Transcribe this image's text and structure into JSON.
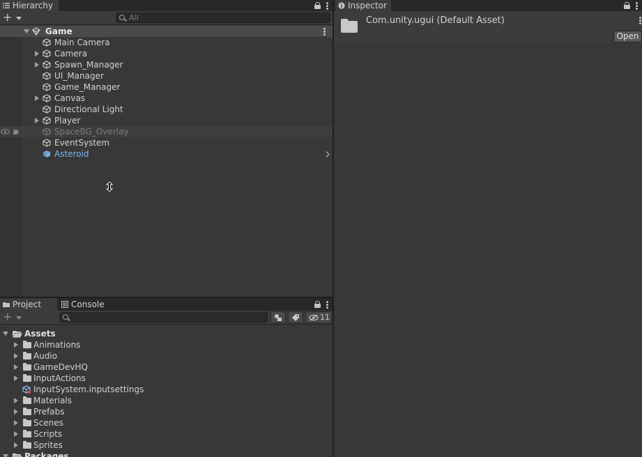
{
  "hierarchy": {
    "tab_label": "Hierarchy",
    "search_placeholder": "All",
    "scene_name": "Game",
    "items": [
      {
        "label": "Main Camera",
        "expandable": false
      },
      {
        "label": "Camera",
        "expandable": true
      },
      {
        "label": "Spawn_Manager",
        "expandable": true
      },
      {
        "label": "UI_Manager",
        "expandable": false
      },
      {
        "label": "Game_Manager",
        "expandable": false
      },
      {
        "label": "Canvas",
        "expandable": true
      },
      {
        "label": "Directional Light",
        "expandable": false
      },
      {
        "label": "Player",
        "expandable": true
      },
      {
        "label": "SpaceBG_Overlay",
        "expandable": false,
        "hidden": true
      },
      {
        "label": "EventSystem",
        "expandable": false
      },
      {
        "label": "Asteroid",
        "expandable": false,
        "prefab": true
      }
    ]
  },
  "inspector": {
    "tab_label": "Inspector",
    "asset_title": "Com.unity.ugui (Default Asset)",
    "open_button": "Open"
  },
  "project": {
    "tab_project": "Project",
    "tab_console": "Console",
    "hidden_count": "11",
    "root_assets": "Assets",
    "items": [
      {
        "label": "Animations",
        "type": "folder"
      },
      {
        "label": "Audio",
        "type": "folder"
      },
      {
        "label": "GameDevHQ",
        "type": "folder"
      },
      {
        "label": "InputActions",
        "type": "folder"
      },
      {
        "label": "InputSystem.inputsettings",
        "type": "asset"
      },
      {
        "label": "Materials",
        "type": "folder"
      },
      {
        "label": "Prefabs",
        "type": "folder"
      },
      {
        "label": "Scenes",
        "type": "folder"
      },
      {
        "label": "Scripts",
        "type": "folder"
      },
      {
        "label": "Sprites",
        "type": "folder"
      }
    ],
    "root_packages": "Packages"
  },
  "colors": {
    "prefab_blue": "#7cb4f5",
    "hidden_gray": "#7c7c7c"
  }
}
